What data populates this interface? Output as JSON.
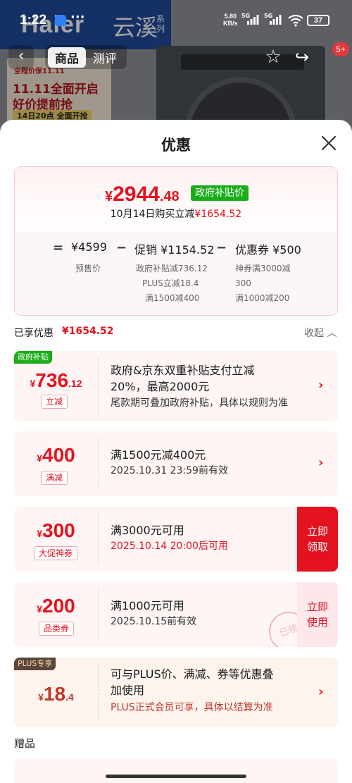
{
  "status_bar": {
    "time": "1:22",
    "dots": "···",
    "net_speed": "5.80",
    "net_unit": "KB/s",
    "signal1": "5G",
    "signal2": "5G",
    "battery": "37"
  },
  "background": {
    "brand_logo": "Haier",
    "brand_series": "云溪",
    "brand_series_suffix": "系列",
    "promo_line1": "全程价保11.11",
    "promo_line2": "11.11全面开启",
    "promo_line3": "好价提前抢",
    "promo_line4": "14日20点 全面开抢"
  },
  "nav": {
    "tabs": [
      {
        "label": "商品",
        "active": true
      },
      {
        "label": "测评",
        "active": false
      }
    ],
    "cart_badge": "5+"
  },
  "sheet": {
    "title": "优惠"
  },
  "summary": {
    "currency": "¥",
    "price_int": "2944",
    "price_dec": ".48",
    "badge": "政府补贴价",
    "line_prefix": "10月14日购买立减",
    "line_amount": "¥1654.52",
    "calc": {
      "eq": "=",
      "minus": "−",
      "presale_value": "¥4599",
      "presale_label": "预售价",
      "promo_value": "促销 ¥1154.52",
      "promo_details": [
        "政府补贴减736.12",
        "PLUS立减18.4",
        "满1500减400"
      ],
      "coupon_value": "优惠券 ¥500",
      "coupon_details": [
        "神券满3000减",
        "300",
        "满1000减200"
      ]
    }
  },
  "applied": {
    "label": "已享优惠",
    "amount": "¥1654.52",
    "collapse": "收起 ︿"
  },
  "cards": [
    {
      "corner": "政府补贴",
      "currency": "¥",
      "int": "736",
      "dec": ".12",
      "tag": "立减",
      "line1": "政府&京东双重补贴支付立减",
      "line1b": "20%，最高2000元",
      "line2": "尾款期可叠加政府补贴，具体以规则为准",
      "chevron": "›"
    },
    {
      "currency": "¥",
      "int": "400",
      "tag": "满减",
      "line1": "满1500元减400元",
      "line2": "2025.10.31 23:59前有效",
      "chevron": "›"
    },
    {
      "currency": "¥",
      "int": "300",
      "tag": "大促神券",
      "line1": "满3000元可用",
      "line2": "2025.10.14 20:00后可用",
      "action": "立即领取"
    },
    {
      "currency": "¥",
      "int": "200",
      "tag": "品类券",
      "line1": "满1000元可用",
      "line2": "2025.10.15前有效",
      "action": "立即使用",
      "stamp": "已领"
    },
    {
      "corner": "PLUS专享",
      "currency": "¥",
      "int": "18",
      "dec": ".4",
      "line1": "可与PLUS价、满减、券等优惠叠",
      "line1b": "加使用",
      "line2": "PLUS正式会员可享，具体以结算为准",
      "chevron": "›"
    }
  ],
  "gifts": {
    "label": "赠品"
  }
}
